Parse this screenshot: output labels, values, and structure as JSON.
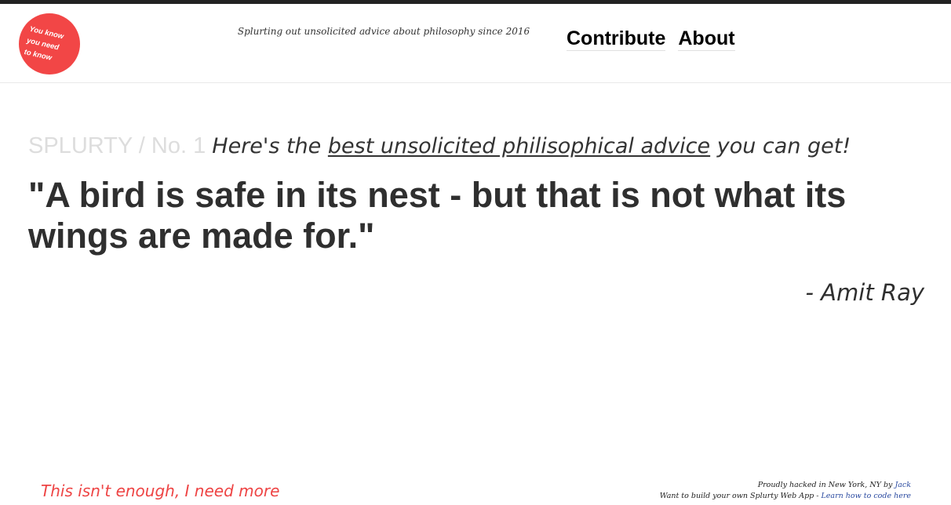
{
  "header": {
    "logo": {
      "line1": "You know",
      "line2": "you need",
      "line3": "to know"
    },
    "tagline": "Splurting out unsolicited advice about philosophy since 2016",
    "nav": [
      {
        "label": "Contribute"
      },
      {
        "label": "About"
      }
    ]
  },
  "main": {
    "brand": "SPLURTY / No. 1",
    "intro_prefix": "Here's the",
    "intro_link": "best unsolicited philisophical advice",
    "intro_suffix": "you can get!",
    "quote": "\"A bird is safe in its nest - but that is not what its wings are made for.\"",
    "author": "- Amit Ray"
  },
  "bottom": {
    "more_link": "This isn't enough, I need more"
  },
  "footer": {
    "line1_prefix": "Proudly hacked in New York, NY by",
    "line1_link": "Jack",
    "line2_prefix": "Want to build your own Splurty Web App -",
    "line2_link": "Learn how to code here"
  },
  "colors": {
    "accent": "#f24646",
    "text": "#2f2f2f",
    "brand_gray": "#dddddd",
    "footer_link": "#2a4aa0"
  }
}
